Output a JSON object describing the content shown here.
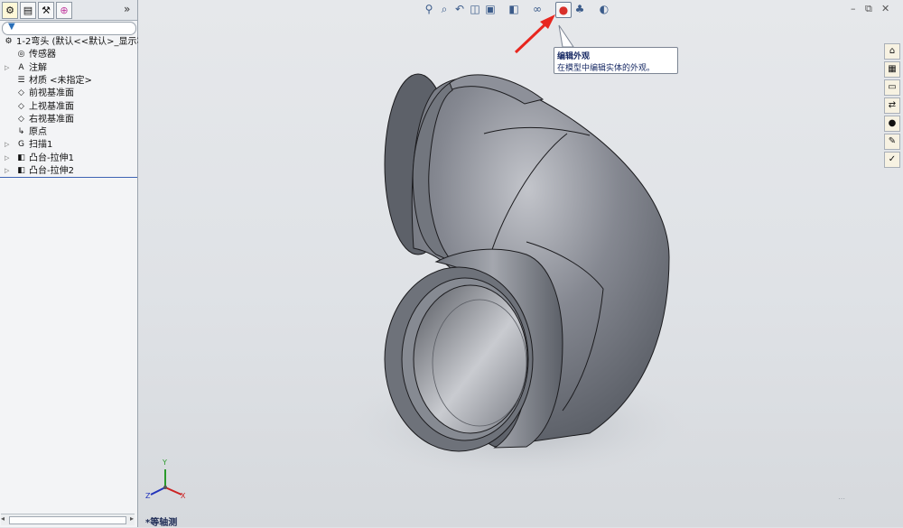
{
  "panel": {
    "tab_more": "»",
    "filter_icon": "▼",
    "tree": [
      {
        "label": "1-2弯头  (默认<<默认>_显示状",
        "icon": "part-icon",
        "glyph": "⚙",
        "indent": 0,
        "expander": ""
      },
      {
        "label": "传感器",
        "icon": "sensor-icon",
        "glyph": "◎",
        "indent": 1,
        "expander": ""
      },
      {
        "label": "注解",
        "icon": "annotation-icon",
        "glyph": "A",
        "indent": 1,
        "expander": "▷"
      },
      {
        "label": "材质 <未指定>",
        "icon": "material-icon",
        "glyph": "☰",
        "indent": 1,
        "expander": ""
      },
      {
        "label": "前视基准面",
        "icon": "plane-icon",
        "glyph": "◇",
        "indent": 1,
        "expander": ""
      },
      {
        "label": "上视基准面",
        "icon": "plane-icon",
        "glyph": "◇",
        "indent": 1,
        "expander": ""
      },
      {
        "label": "右视基准面",
        "icon": "plane-icon",
        "glyph": "◇",
        "indent": 1,
        "expander": ""
      },
      {
        "label": "原点",
        "icon": "origin-icon",
        "glyph": "↳",
        "indent": 1,
        "expander": ""
      },
      {
        "label": "扫描1",
        "icon": "sweep-icon",
        "glyph": "G",
        "indent": 1,
        "expander": "▷"
      },
      {
        "label": "凸台-拉伸1",
        "icon": "extrude-icon",
        "glyph": "◧",
        "indent": 1,
        "expander": "▷"
      },
      {
        "label": "凸台-拉伸2",
        "icon": "extrude-icon",
        "glyph": "◧",
        "indent": 1,
        "expander": "▷"
      }
    ]
  },
  "hud": {
    "tooltip_title": "编辑外观",
    "tooltip_desc": "在模型中编辑实体的外观。"
  },
  "window": {
    "minimize": "–",
    "restore": "⧉",
    "close": "✕"
  },
  "viewport": {
    "view_label": "*等轴测",
    "triad_x": "X",
    "triad_y": "Y",
    "triad_z": "Z"
  },
  "colors": {
    "accent_arrow": "#e8261e",
    "model_gray": "#7b7f88"
  }
}
